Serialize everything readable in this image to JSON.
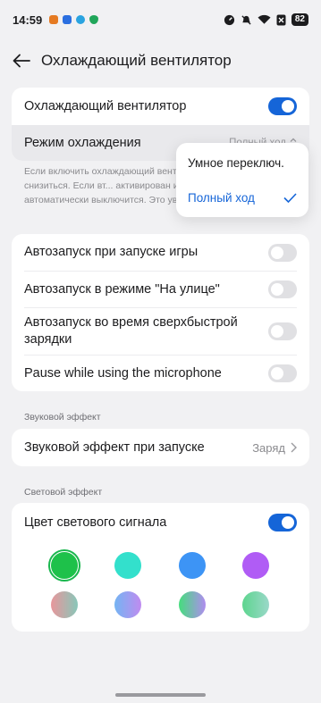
{
  "status": {
    "time": "14:59",
    "battery": "82"
  },
  "header": {
    "title": "Охлаждающий вентилятор"
  },
  "fan_card": {
    "fan_label": "Охлаждающий вентилятор",
    "fan_on": true,
    "mode_label": "Режим охлаждения",
    "mode_value": "Полный ход"
  },
  "description": "Если включить охлаждающий вентил... телефона может снизиться. Если вт... активирован или экран заблокирова... автоматически выключится. Это уве...",
  "popup": {
    "options": [
      "Умное переключ.",
      "Полный ход"
    ],
    "selected": "Полный ход"
  },
  "auto_card": {
    "items": [
      {
        "label": "Автозапуск при запуске игры",
        "on": false
      },
      {
        "label": "Автозапуск в режиме \"На улице\"",
        "on": false
      },
      {
        "label": "Автозапуск во время сверхбыстрой зарядки",
        "on": false
      },
      {
        "label": "Pause while using the microphone",
        "on": false
      }
    ]
  },
  "sound_section": {
    "header": "Звуковой эффект",
    "label": "Звуковой эффект при запуске",
    "value": "Заряд"
  },
  "light_section": {
    "header": "Световой эффект",
    "label": "Цвет светового сигнала",
    "on": true
  },
  "colors": {
    "accent": "#1565d8",
    "swatches_row1": [
      "#1ec14a",
      "#33e0cc",
      "#3d94f5",
      "#b05cf5"
    ],
    "selected_swatch_index": 0
  }
}
